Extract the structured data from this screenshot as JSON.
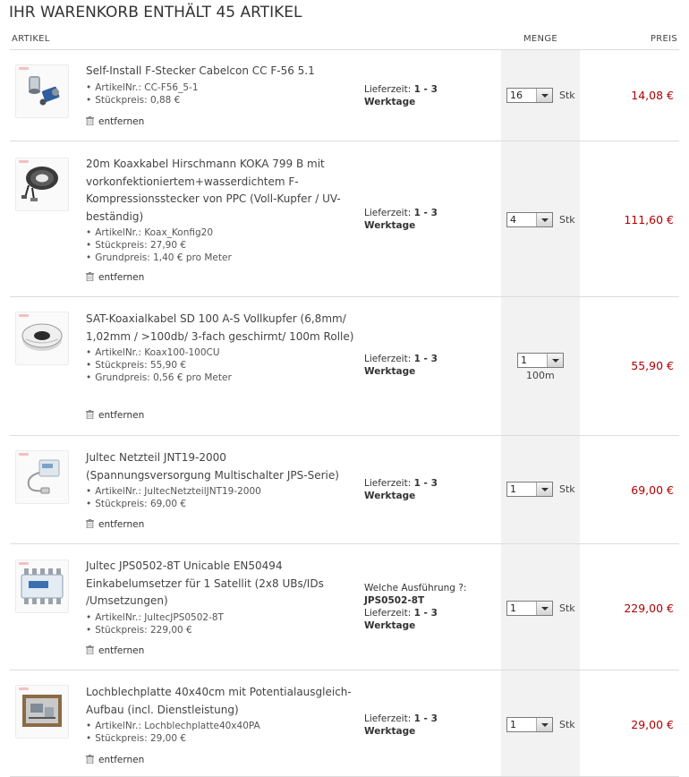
{
  "cart": {
    "title": "IHR WARENKORB ENTHÄLT 45 ARTIKEL",
    "columns": {
      "artikel": "ARTIKEL",
      "menge": "MENGE",
      "preis": "PREIS"
    },
    "remove_label": "entfernen",
    "stk_label": "Stk",
    "items": [
      {
        "name": "Self-Install F-Stecker Cabelcon CC F-56 5.1",
        "details": [
          "ArtikelNr.: CC-F56_5-1",
          "Stückpreis: 0,88 €"
        ],
        "delivery": {
          "variant_label": "",
          "variant_value": "",
          "label": "Lieferzeit:",
          "range": "1 - 3",
          "unit": "Werktage"
        },
        "quantity": "16",
        "unit_note": "",
        "price": "14,08 €",
        "icon": "f-connector-icon"
      },
      {
        "name": "20m Koaxkabel Hirschmann KOKA 799 B mit vorkonfektioniertem+wasserdichtem F-Kompressionsstecker von PPC (Voll-Kupfer / UV-beständig)",
        "details": [
          "ArtikelNr.: Koax_Konfig20",
          "Stückpreis: 27,90 €",
          "Grundpreis: 1,40 € pro Meter"
        ],
        "delivery": {
          "variant_label": "",
          "variant_value": "",
          "label": "Lieferzeit:",
          "range": "1 - 3",
          "unit": "Werktage"
        },
        "quantity": "4",
        "unit_note": "",
        "price": "111,60 €",
        "icon": "coax-coil-icon"
      },
      {
        "name": "SAT-Koaxialkabel SD 100 A-S Vollkupfer (6,8mm/ 1,02mm / >100db/ 3-fach geschirmt/ 100m Rolle)",
        "details": [
          "ArtikelNr.: Koax100-100CU",
          "Stückpreis: 55,90 €",
          "Grundpreis: 0,56 € pro Meter"
        ],
        "delivery": {
          "variant_label": "",
          "variant_value": "",
          "label": "Lieferzeit:",
          "range": "1 - 3",
          "unit": "Werktage"
        },
        "quantity": "1",
        "unit_note": "100m",
        "price": "55,90 €",
        "icon": "cable-reel-icon"
      },
      {
        "name": "Jultec Netzteil JNT19-2000 (Spannungsversorgung Multischalter JPS-Serie)",
        "details": [
          "ArtikelNr.: JultecNetzteilJNT19-2000",
          "Stückpreis: 69,00 €"
        ],
        "delivery": {
          "variant_label": "",
          "variant_value": "",
          "label": "Lieferzeit:",
          "range": "1 - 3",
          "unit": "Werktage"
        },
        "quantity": "1",
        "unit_note": "",
        "price": "69,00 €",
        "icon": "power-supply-icon"
      },
      {
        "name": "Jultec JPS0502-8T Unicable EN50494 Einkabelumsetzer für 1 Satellit (2x8 UBs/IDs /Umsetzungen)",
        "details": [
          "ArtikelNr.: JultecJPS0502-8T",
          "Stückpreis: 229,00 €"
        ],
        "delivery": {
          "variant_label": "Welche Ausführung ?:",
          "variant_value": "JPS0502-8T",
          "label": "Lieferzeit:",
          "range": "1 - 3",
          "unit": "Werktage"
        },
        "quantity": "1",
        "unit_note": "",
        "price": "229,00 €",
        "icon": "multiswitch-icon"
      },
      {
        "name": "Lochblechplatte 40x40cm mit Potentialausgleich-Aufbau (incl. Dienstleistung)",
        "details": [
          "ArtikelNr.: Lochblechplatte40x40PA",
          "Stückpreis: 29,00 €"
        ],
        "delivery": {
          "variant_label": "",
          "variant_value": "",
          "label": "Lieferzeit:",
          "range": "1 - 3",
          "unit": "Werktage"
        },
        "quantity": "1",
        "unit_note": "",
        "price": "29,00 €",
        "icon": "mounting-plate-icon"
      }
    ]
  },
  "colors": {
    "price": "#b00000",
    "qty_column_bg": "#f2f2f2",
    "divider": "#dcdcdc"
  }
}
